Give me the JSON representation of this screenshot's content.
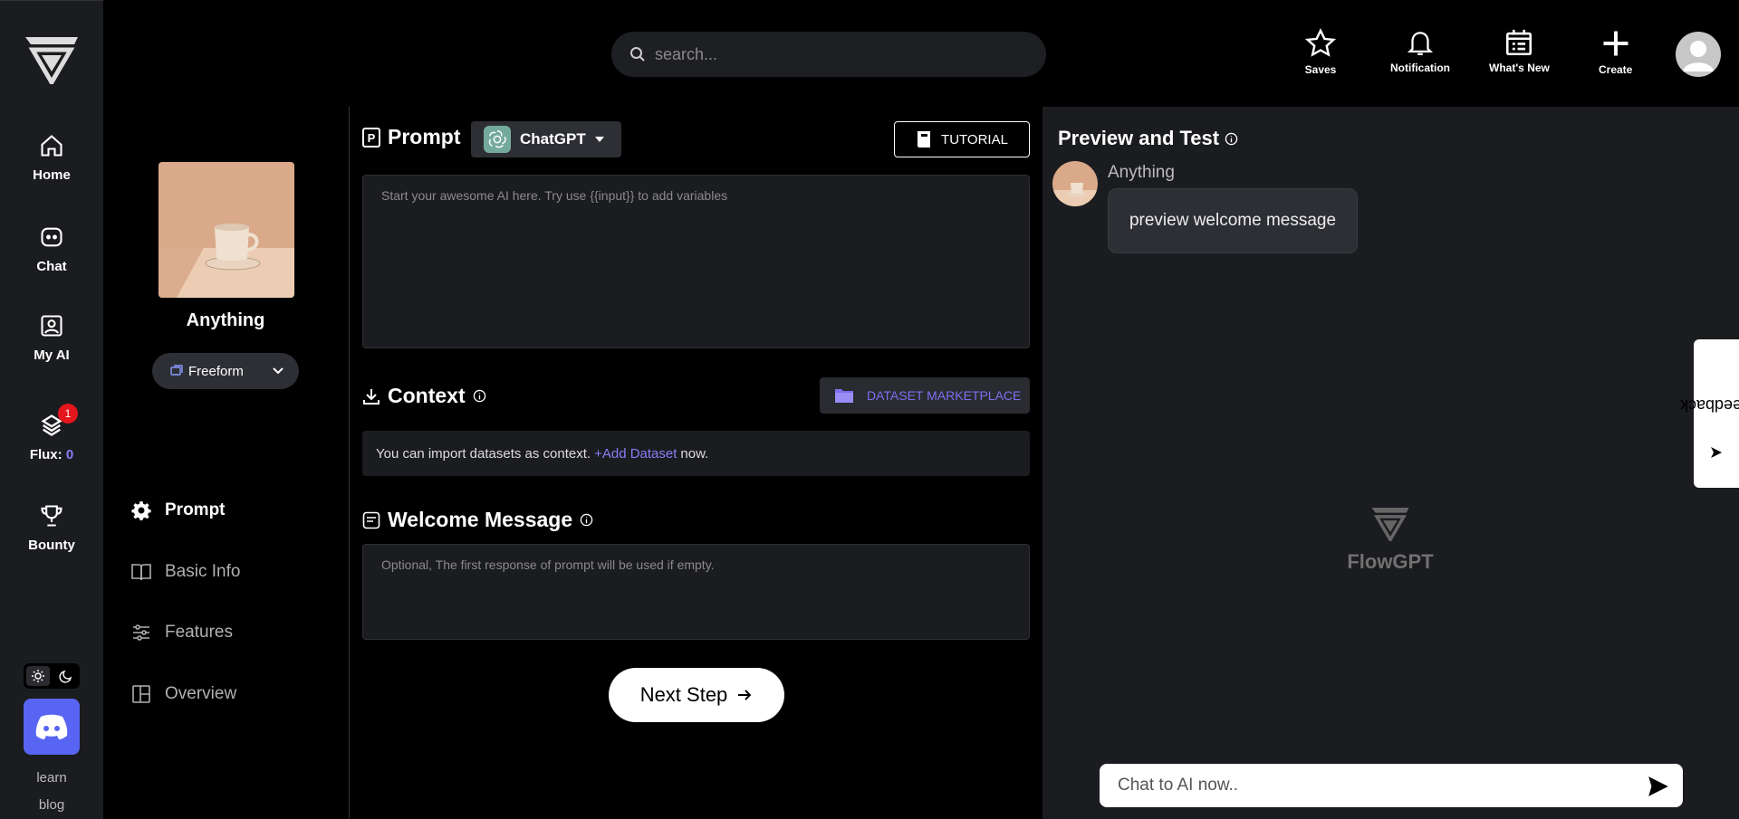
{
  "app": {
    "brand": "FlowGPT"
  },
  "rail": {
    "items": [
      {
        "label": "Home",
        "icon": "home-icon"
      },
      {
        "label": "Chat",
        "icon": "chat-bot-icon"
      },
      {
        "label": "My AI",
        "icon": "my-ai-icon"
      },
      {
        "label": "Flux:",
        "icon": "flux-icon",
        "badge": "1",
        "count": "0"
      },
      {
        "label": "Bounty",
        "icon": "trophy-icon"
      }
    ],
    "links": [
      "learn",
      "blog"
    ]
  },
  "header": {
    "search_placeholder": "search...",
    "buttons": [
      {
        "label": "Saves",
        "icon": "star-icon"
      },
      {
        "label": "Notification",
        "icon": "bell-icon"
      },
      {
        "label": "What's New",
        "icon": "calendar-icon"
      },
      {
        "label": "Create",
        "icon": "plus-icon"
      }
    ]
  },
  "ai": {
    "name": "Anything",
    "mode": "Freeform"
  },
  "steps": [
    "Prompt",
    "Basic Info",
    "Features",
    "Overview"
  ],
  "form": {
    "prompt_title": "Prompt",
    "model": "ChatGPT",
    "tutorial": "TUTORIAL",
    "prompt_placeholder": "Start your awesome AI here. Try use {{input}} to add variables",
    "context_title": "Context",
    "dataset_btn": "DATASET MARKETPLACE",
    "context_info_pre": "You can import datasets as context.",
    "context_info_link": "+Add Dataset",
    "context_info_post": "now.",
    "welcome_title": "Welcome Message",
    "welcome_placeholder": "Optional, The first response of prompt will be used if empty.",
    "next": "Next Step"
  },
  "preview": {
    "title": "Preview and Test",
    "bot_name": "Anything",
    "message": "preview welcome message",
    "watermark": "FlowGPT",
    "chat_placeholder": "Chat to AI now..",
    "feedback": "Feedback"
  },
  "colors": {
    "accent": "#8b7cf6",
    "panel": "#1b1c1f",
    "discord": "#5865f2",
    "badge": "#e5161d"
  }
}
